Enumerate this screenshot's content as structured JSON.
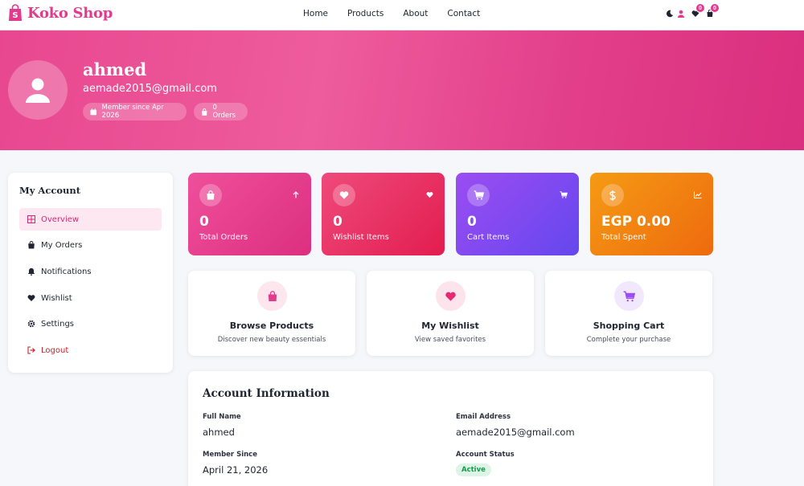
{
  "brand": {
    "name": "Koko Shop",
    "icon": "shopping-bag-icon",
    "color": "#e43a8e"
  },
  "nav": {
    "links": [
      "Home",
      "Products",
      "About",
      "Contact"
    ]
  },
  "nav_icons": {
    "theme": "moon-icon",
    "user": "user-icon",
    "wishlist_count": "0",
    "cart_count": "0"
  },
  "hero": {
    "name": "ahmed",
    "email": "aemade2015@gmail.com",
    "member_since": "Member since Apr 2026",
    "orders": "0 Orders"
  },
  "sidebar": {
    "title": "My Account",
    "items": [
      {
        "label": "Overview",
        "icon": "grid-icon",
        "active": true
      },
      {
        "label": "My Orders",
        "icon": "bag-icon"
      },
      {
        "label": "Notifications",
        "icon": "bell-icon"
      },
      {
        "label": "Wishlist",
        "icon": "heart-icon"
      },
      {
        "label": "Settings",
        "icon": "gear-icon"
      },
      {
        "label": "Logout",
        "icon": "logout-icon",
        "color": "#d31f2d"
      }
    ]
  },
  "stats": [
    {
      "value": "0",
      "label": "Total Orders",
      "icon": "bag-icon",
      "corner": "arrow-up-icon",
      "color": "#e43a8e"
    },
    {
      "value": "0",
      "label": "Wishlist Items",
      "icon": "heart-icon",
      "corner": "heart-icon",
      "color": "#e8285f"
    },
    {
      "value": "0",
      "label": "Cart Items",
      "icon": "cart-icon",
      "corner": "cart-icon",
      "color": "#7c4bf0"
    },
    {
      "value": "EGP 0.00",
      "label": "Total Spent",
      "icon": "dollar-icon",
      "corner": "chart-icon",
      "color": "#f28412"
    }
  ],
  "actions": [
    {
      "title": "Browse Products",
      "desc": "Discover new beauty essentials",
      "icon": "bag-icon"
    },
    {
      "title": "My Wishlist",
      "desc": "View saved favorites",
      "icon": "heart-icon"
    },
    {
      "title": "Shopping Cart",
      "desc": "Complete your purchase",
      "icon": "cart-icon"
    }
  ],
  "account_info": {
    "title": "Account Information",
    "full_name_label": "Full Name",
    "full_name": "ahmed",
    "email_label": "Email Address",
    "email": "aemade2015@gmail.com",
    "member_since_label": "Member Since",
    "member_since": "April 21, 2026",
    "status_label": "Account Status",
    "status": "Active"
  }
}
